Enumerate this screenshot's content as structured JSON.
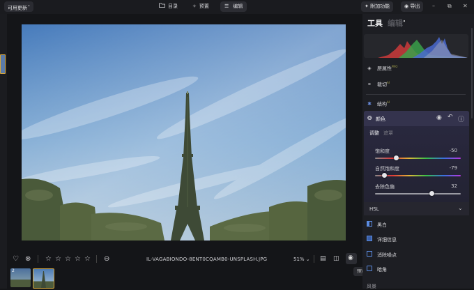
{
  "topbar": {
    "update_label": "可用更新",
    "nav": [
      {
        "label": "目录",
        "icon": "folder-icon"
      },
      {
        "label": "预置",
        "icon": "sparkle-icon"
      },
      {
        "label": "编辑",
        "icon": "sliders-icon"
      }
    ],
    "addon_label": "附加功能",
    "export_label": "导出"
  },
  "photo": {
    "filename": "IL-VAGABIONDO-8ENT0CQAMB0-UNSPLASH.JPG",
    "zoom": "51%"
  },
  "filmstrip": {
    "badge": "2"
  },
  "tooltip": "预览",
  "panel": {
    "title_tools": "工具",
    "title_edit": "编辑",
    "sections": [
      {
        "label": "层属性",
        "icon": "layers-icon",
        "tag": "PRO"
      },
      {
        "label": "裁切",
        "icon": "crop-icon",
        "tag": "AI"
      },
      {
        "label": "结构",
        "icon": "structure-icon",
        "tag": "AI"
      }
    ],
    "color_section": {
      "label": "颜色",
      "tabs": [
        "调整",
        "遮罩"
      ],
      "sliders": [
        {
          "label": "饱和度",
          "value": "-50",
          "pos": 0.25
        },
        {
          "label": "自然饱和度",
          "value": "-79",
          "pos": 0.11
        },
        {
          "label": "去除色偏",
          "value": "32",
          "pos": 0.66
        }
      ]
    },
    "hsl_label": "HSL",
    "tools": [
      {
        "label": "黑白",
        "icon": "bw-icon"
      },
      {
        "label": "详细信息",
        "icon": "detail-icon"
      },
      {
        "label": "消除噪点",
        "icon": "denoise-icon"
      },
      {
        "label": "暗角",
        "icon": "vignette-icon"
      }
    ],
    "footer_label": "风景"
  },
  "colors": {
    "accent": "#5b5fc7",
    "panel_bg": "#1d1e23",
    "selected_row": "#2b2a40"
  }
}
